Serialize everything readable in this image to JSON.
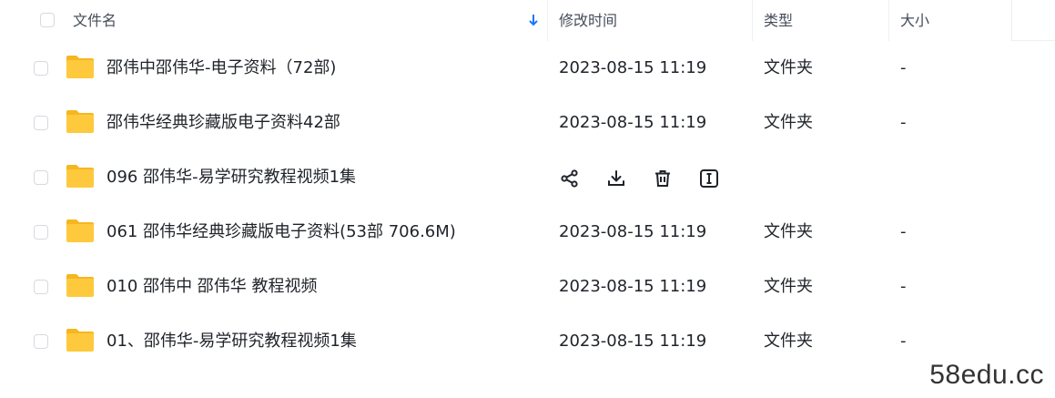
{
  "header": {
    "name_label": "文件名",
    "time_label": "修改时间",
    "type_label": "类型",
    "size_label": "大小",
    "sort_icon": "sort-down-arrow"
  },
  "rows": [
    {
      "name": "邵伟中邵伟华-电子资料（72部)",
      "time": "2023-08-15 11:19",
      "type": "文件夹",
      "size": "-"
    },
    {
      "name": "邵伟华经典珍藏版电子资料42部",
      "time": "2023-08-15 11:19",
      "type": "文件夹",
      "size": "-"
    },
    {
      "name": "096 邵伟华-易学研究教程视频1集",
      "time": "",
      "type": "",
      "size": ""
    },
    {
      "name": "061 邵伟华经典珍藏版电子资料(53部  706.6M)",
      "time": "2023-08-15 11:19",
      "type": "文件夹",
      "size": "-"
    },
    {
      "name": "010 邵伟中 邵伟华 教程视频",
      "time": "2023-08-15 11:19",
      "type": "文件夹",
      "size": "-"
    },
    {
      "name": "01、邵伟华-易学研究教程视频1集",
      "time": "2023-08-15 11:19",
      "type": "文件夹",
      "size": "-"
    }
  ],
  "hover_actions": [
    "share-icon",
    "download-icon",
    "delete-icon",
    "rename-icon"
  ],
  "watermark": "58edu.cc",
  "colors": {
    "folder": "#FFC93D",
    "folder_dark": "#F5B720",
    "accent": "#1677ff"
  }
}
